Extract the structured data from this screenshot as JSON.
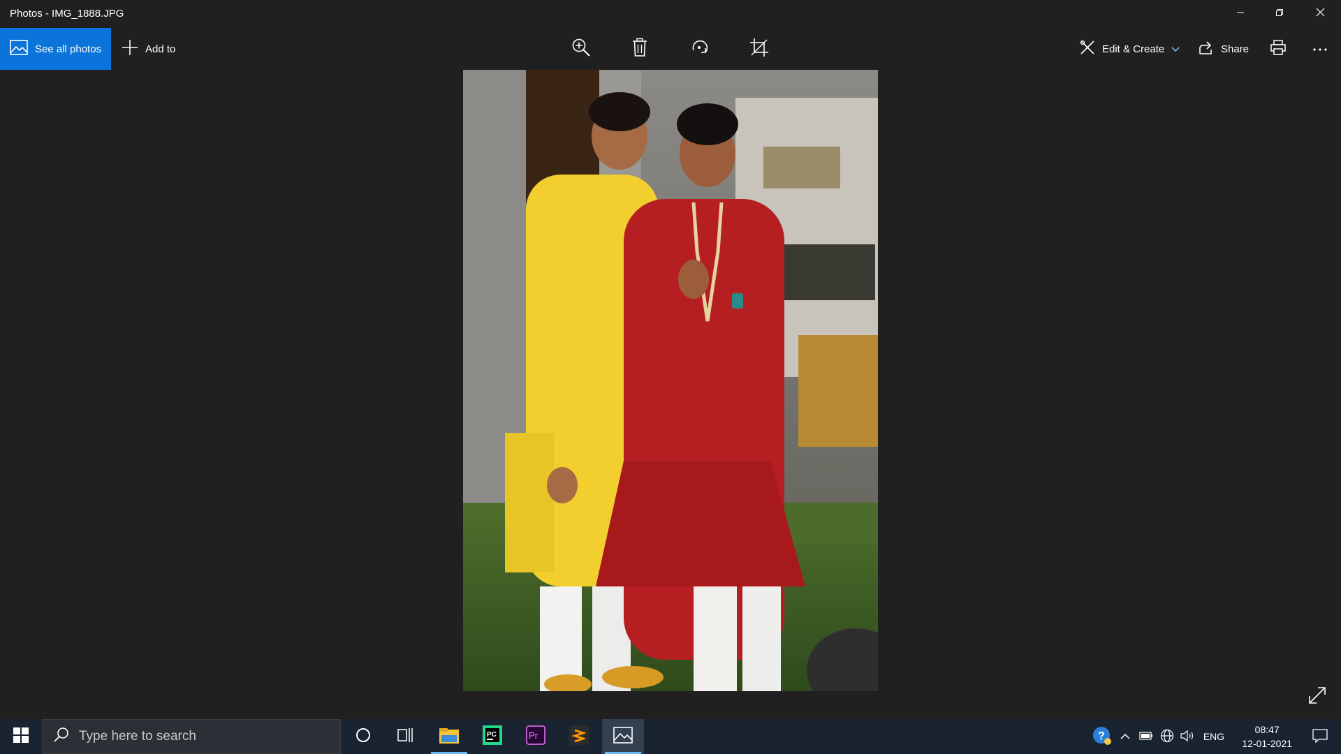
{
  "window": {
    "title": "Photos - IMG_1888.JPG",
    "controls": [
      "minimize-icon",
      "restore-icon",
      "close-icon"
    ]
  },
  "toolbar": {
    "see_all_photos": "See all photos",
    "add_to": "Add to",
    "icons": [
      "zoom-in-icon",
      "delete-icon",
      "rotate-icon",
      "crop-icon"
    ],
    "edit_create": "Edit & Create",
    "share": "Share",
    "print_icon": "print-icon",
    "more_icon": "more-icon"
  },
  "colors": {
    "accent": "#0a74da",
    "background": "#202020",
    "taskbar": "#1a2330"
  },
  "taskbar": {
    "search_placeholder": "Type here to search",
    "apps": [
      "cortana-icon",
      "task-view-icon",
      "file-explorer-icon",
      "pycharm-icon",
      "premiere-pro-icon",
      "sublime-text-icon",
      "photos-icon"
    ],
    "tray": {
      "language": "ENG",
      "time": "08:47",
      "date": "12-01-2021"
    }
  }
}
